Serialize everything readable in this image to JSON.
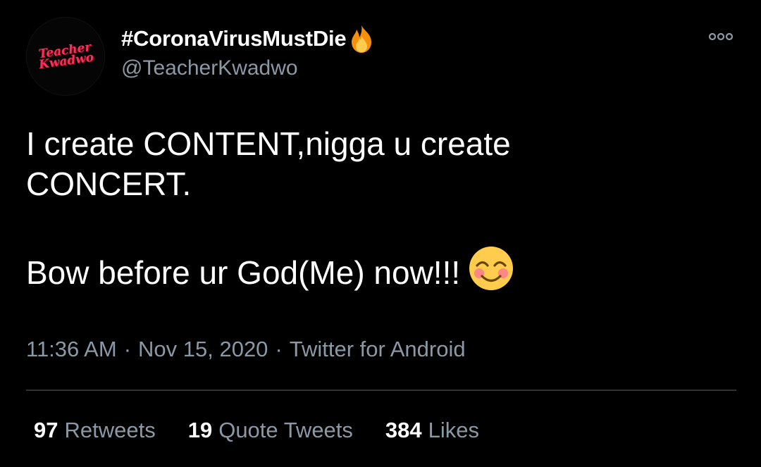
{
  "profile": {
    "display_name": "#CoronaVirusMustDie",
    "name_emoji_icon": "fire-icon",
    "handle": "@TeacherKwadwo",
    "avatar_logo_text": "Teacher Kwadwo",
    "more_icon": "more-options-icon"
  },
  "tweet": {
    "text": "I create CONTENT,nigga u create\nCONCERT.\n\nBow before ur God(Me) now!!!",
    "emoji_icon": "smiling-face-with-smiling-eyes-icon"
  },
  "meta": {
    "time": "11:36 AM",
    "date": "Nov 15, 2020",
    "source": "Twitter for Android",
    "separator": "·"
  },
  "stats": {
    "retweets_count": "97",
    "retweets_label": "Retweets",
    "quotes_count": "19",
    "quotes_label": "Quote Tweets",
    "likes_count": "384",
    "likes_label": "Likes"
  },
  "colors": {
    "background": "#000000",
    "primary_text": "#ffffff",
    "secondary_text": "#8b98a5",
    "divider": "#2f3336",
    "avatar_logo": "#ff2f5c"
  }
}
